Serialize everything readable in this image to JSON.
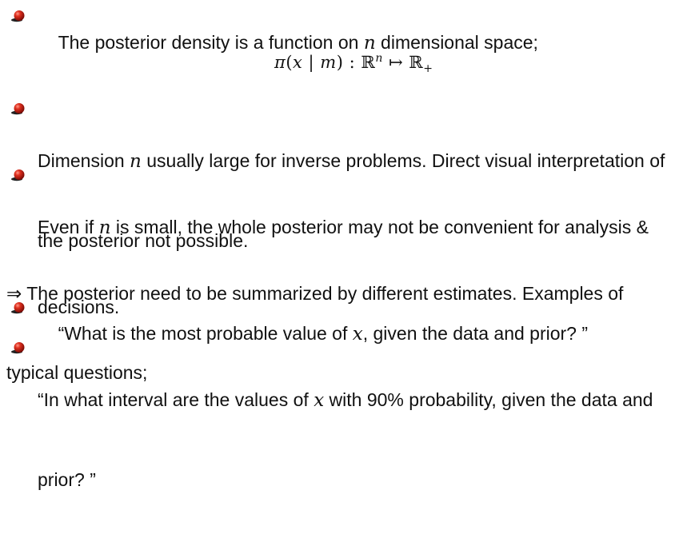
{
  "bullets": [
    {
      "line1_a": "The posterior density is a function on ",
      "line1_math": "n",
      "line1_b": " dimensional space;"
    },
    {
      "line1_a": "Dimension ",
      "line1_math": "n",
      "line1_b": " usually large for inverse problems. Direct visual interpretation of",
      "line2": "the posterior not possible."
    },
    {
      "line1_a": "Even if ",
      "line1_math": "n",
      "line1_b": " is small, the whole posterior may not be convenient for analysis &",
      "line2": "decisions."
    },
    {
      "line1_a": "“What is the most probable value of ",
      "line1_math": "x",
      "line1_b": ", given the data and prior? ”"
    },
    {
      "line1_a": "“In what interval are the values of ",
      "line1_math": "x",
      "line1_b": " with 90% probability, given the data and",
      "line2": "prior? ”"
    }
  ],
  "formula": {
    "pi": "π",
    "open": "(",
    "x": "x",
    "bar": " | ",
    "m": "m",
    "close": ")",
    "colon": " : ",
    "R": "ℝ",
    "n": "n",
    "mapsto": " ↦ ",
    "R2": "ℝ",
    "plus": "+"
  },
  "summary": {
    "arrow": "⇒",
    "line1": " The posterior need to be summarized by different estimates. Examples of",
    "line2": "typical questions;"
  },
  "colors": {
    "bullet_light": "#f25b4a",
    "bullet_dark": "#8e0e06",
    "shadow": "#222222",
    "text": "#111111"
  }
}
